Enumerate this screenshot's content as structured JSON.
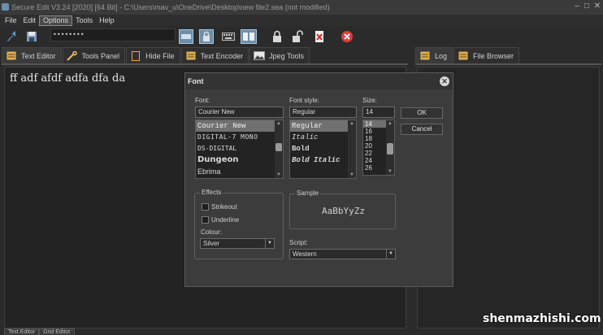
{
  "window": {
    "title": "Secure Edit V3.24 [2020] [64 Bit] - C:\\Users\\mav_u\\OneDrive\\Desktop\\new file2.sea (not modified)",
    "controls": [
      "–",
      "□",
      "✕"
    ]
  },
  "menu": [
    "File",
    "Edit",
    "Options",
    "Tools",
    "Help"
  ],
  "toolbar": {
    "password_value": "••••••••"
  },
  "left_tabs": [
    {
      "label": "Text Editor",
      "icon": "notepad-icon"
    },
    {
      "label": "Tools Panel",
      "icon": "tools-icon"
    },
    {
      "label": "Hide File",
      "icon": "file-icon"
    },
    {
      "label": "Text Encoder",
      "icon": "notepad-icon"
    },
    {
      "label": "Jpeg Tools",
      "icon": "image-icon"
    }
  ],
  "right_tabs": [
    {
      "label": "Log",
      "icon": "notepad-icon"
    },
    {
      "label": "File Browser",
      "icon": "notepad-icon"
    }
  ],
  "editor": {
    "text": "ff adf afdf adfa dfa da"
  },
  "bottom_tabs": [
    "Text Editor",
    "Grid Editor"
  ],
  "font_dialog": {
    "title": "Font",
    "font_label": "Font:",
    "font_value": "Courier New",
    "fonts": [
      "Courier New",
      "DIGITAL-7 MONO",
      "DS-DIGITAL",
      "Dungeon",
      "Ebrima"
    ],
    "style_label": "Font style:",
    "style_value": "Regular",
    "styles": [
      "Regular",
      "Italic",
      "Bold",
      "Bold Italic"
    ],
    "size_label": "Size:",
    "size_value": "14",
    "sizes": [
      "14",
      "16",
      "18",
      "20",
      "22",
      "24",
      "26"
    ],
    "ok_label": "OK",
    "cancel_label": "Cancel",
    "effects_label": "Effects",
    "strikeout_label": "Strikeout",
    "underline_label": "Underline",
    "colour_label": "Colour:",
    "colour_value": "Silver",
    "sample_label": "Sample",
    "sample_text": "AaBbYyZz",
    "script_label": "Script:",
    "script_value": "Western"
  },
  "watermark": "shenmazhishi.com"
}
